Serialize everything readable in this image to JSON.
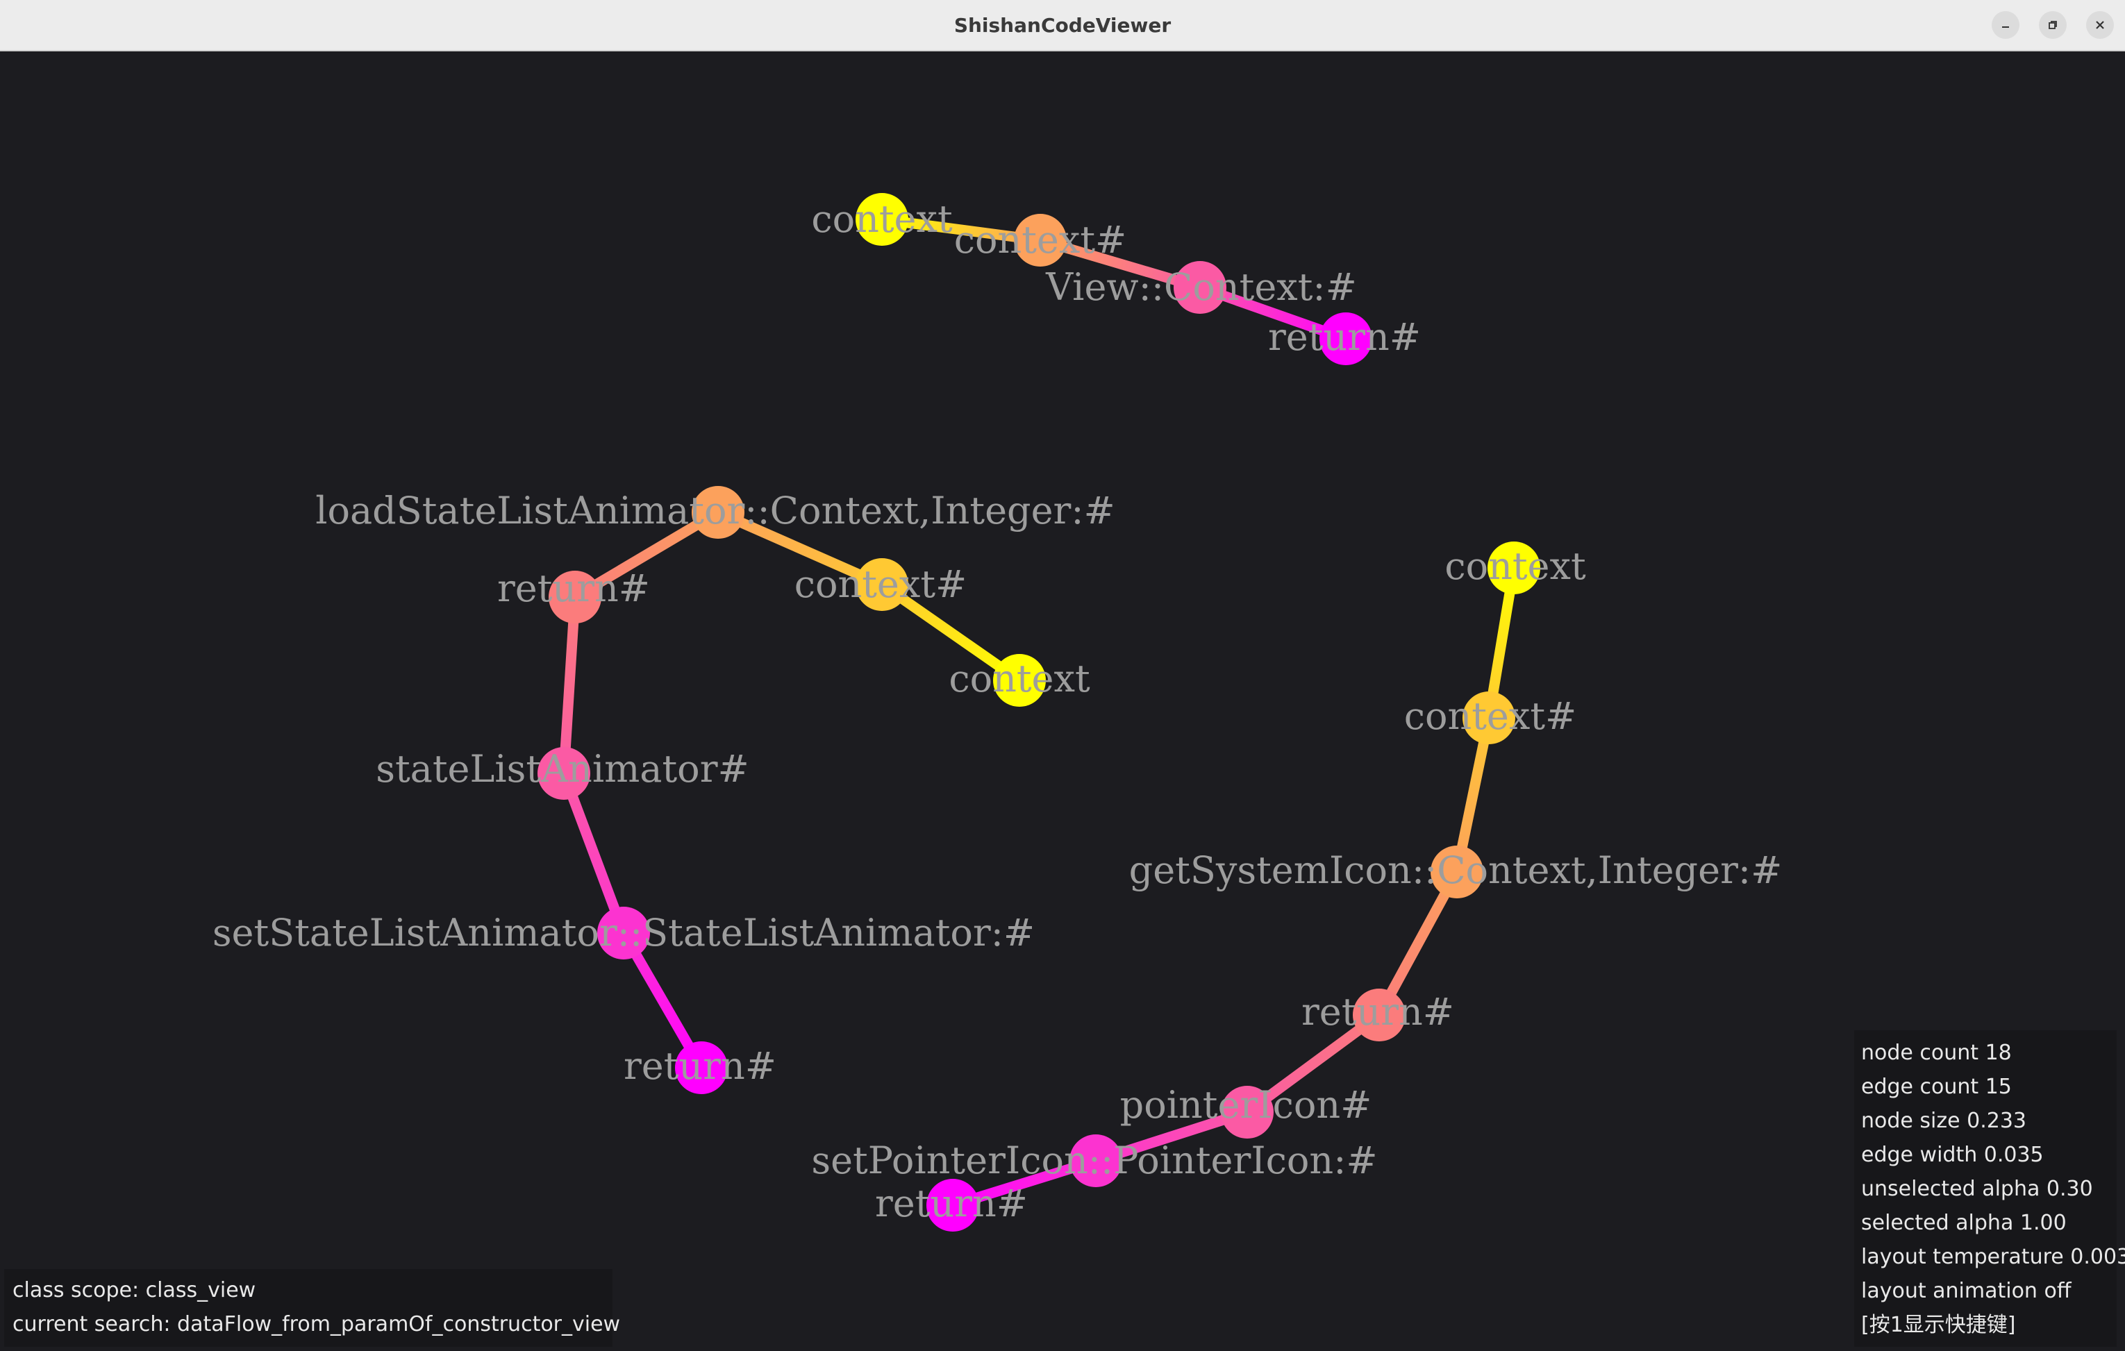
{
  "window": {
    "title": "ShishanCodeViewer",
    "controls": {
      "minimize_icon": "minimize-icon",
      "maximize_icon": "restore-icon",
      "close_icon": "close-icon"
    }
  },
  "graph": {
    "node_colors": {
      "yellow": "#ffff00",
      "gold": "#ffc933",
      "orange": "#fca15c",
      "salmon": "#fb7c7c",
      "pink": "#fb5aa4",
      "hotpink": "#fc33d0",
      "magenta": "#ff00ff"
    },
    "nodes": [
      {
        "id": "a1",
        "label": "context",
        "color": "yellow"
      },
      {
        "id": "a2",
        "label": "context#",
        "color": "orange"
      },
      {
        "id": "a3",
        "label": "View::Context:#",
        "color": "pink"
      },
      {
        "id": "a4",
        "label": "return#",
        "color": "magenta"
      },
      {
        "id": "b1",
        "label": "loadStateListAnimator::Context,Integer:#",
        "color": "orange"
      },
      {
        "id": "b2",
        "label": "return#",
        "color": "salmon"
      },
      {
        "id": "b3",
        "label": "context#",
        "color": "gold"
      },
      {
        "id": "b4",
        "label": "context",
        "color": "yellow"
      },
      {
        "id": "b5",
        "label": "stateListAnimator#",
        "color": "pink"
      },
      {
        "id": "b6",
        "label": "setStateListAnimator::StateListAnimator:#",
        "color": "hotpink"
      },
      {
        "id": "b7",
        "label": "return#",
        "color": "magenta"
      },
      {
        "id": "c1",
        "label": "context",
        "color": "yellow"
      },
      {
        "id": "c2",
        "label": "context#",
        "color": "gold"
      },
      {
        "id": "c3",
        "label": "getSystemIcon::Context,Integer:#",
        "color": "orange"
      },
      {
        "id": "c4",
        "label": "return#",
        "color": "salmon"
      },
      {
        "id": "c5",
        "label": "pointerIcon#",
        "color": "pink"
      },
      {
        "id": "c6",
        "label": "setPointerIcon::PointerIcon:#",
        "color": "hotpink"
      },
      {
        "id": "c7",
        "label": "return#",
        "color": "magenta"
      }
    ],
    "edges": [
      [
        "a1",
        "a2"
      ],
      [
        "a2",
        "a3"
      ],
      [
        "a3",
        "a4"
      ],
      [
        "b4",
        "b3"
      ],
      [
        "b3",
        "b1"
      ],
      [
        "b1",
        "b2"
      ],
      [
        "b2",
        "b5"
      ],
      [
        "b5",
        "b6"
      ],
      [
        "b6",
        "b7"
      ],
      [
        "c1",
        "c2"
      ],
      [
        "c2",
        "c3"
      ],
      [
        "c3",
        "c4"
      ],
      [
        "c4",
        "c5"
      ],
      [
        "c5",
        "c6"
      ],
      [
        "c6",
        "c7"
      ]
    ]
  },
  "status": {
    "class_scope": "class scope: class_view",
    "current_search": "current search: dataFlow_from_paramOf_constructor_view"
  },
  "stats": {
    "node_count": "node count 18",
    "edge_count": "edge count  15",
    "node_size": "node size  0.233",
    "edge_width": "edge width   0.035",
    "unselected_alpha": "unselected alpha 0.30",
    "selected_alpha": "selected alpha 1.00",
    "layout_temperature": "layout temperature 0.003",
    "layout_animation": "layout animation off",
    "shortcut_hint": "[按1显示快捷键]"
  }
}
